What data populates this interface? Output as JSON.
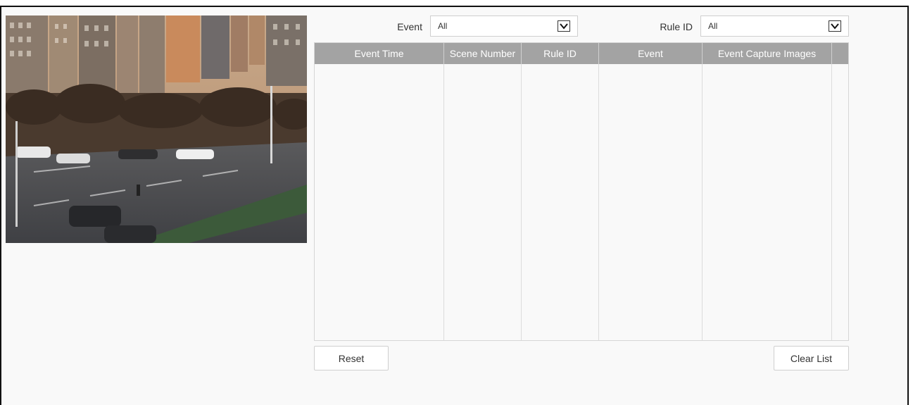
{
  "filters": {
    "event_label": "Event",
    "event_value": "All",
    "rule_label": "Rule ID",
    "rule_value": "All"
  },
  "table": {
    "columns": [
      "Event Time",
      "Scene Number",
      "Rule ID",
      "Event",
      "Event Capture Images"
    ],
    "rows": []
  },
  "buttons": {
    "reset": "Reset",
    "clear_list": "Clear List"
  },
  "colors": {
    "header_bg": "#a3a3a3",
    "page_bg": "#f9f9f9"
  }
}
